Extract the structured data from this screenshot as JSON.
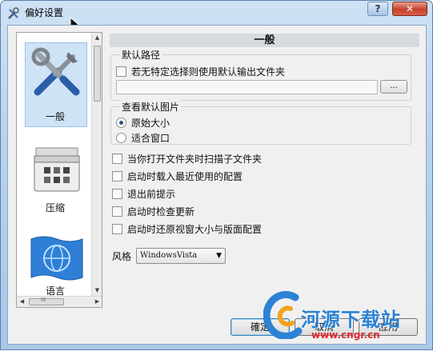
{
  "window": {
    "title": "偏好设置",
    "help_label": "?",
    "close_label": "✕"
  },
  "sidebar": {
    "items": [
      {
        "label": "一般",
        "icon": "tools-icon",
        "selected": true
      },
      {
        "label": "压缩",
        "icon": "compress-icon",
        "selected": false
      },
      {
        "label": "语言",
        "icon": "globe-flag-icon",
        "selected": false
      }
    ],
    "scroll_up": "▲",
    "scroll_down": "▼",
    "scroll_left": "◀",
    "scroll_right": "▶",
    "hthumb_grip": "III"
  },
  "panel": {
    "header": "一般",
    "default_path": {
      "title": "默认路径",
      "checkbox_label": "若无特定选择则使用默认输出文件夹",
      "path_value": "",
      "browse_label": "..."
    },
    "view_image": {
      "title": "查看默认图片",
      "options": [
        "原始大小",
        "适合窗口"
      ],
      "selected_index": 0
    },
    "checkboxes": [
      "当你打开文件夹时扫描子文件夹",
      "启动时载入最近使用的配置",
      "退出前提示",
      "启动时检查更新",
      "启动时还原视窗大小与版面配置"
    ],
    "style": {
      "label": "风格",
      "value": "WindowsVista",
      "dropdown_glyph": "▼"
    }
  },
  "buttons": {
    "ok": "確定",
    "cancel": "取消",
    "apply": "应用"
  },
  "watermark": {
    "text": "河源下载站",
    "url": "www.cngr.cn"
  }
}
